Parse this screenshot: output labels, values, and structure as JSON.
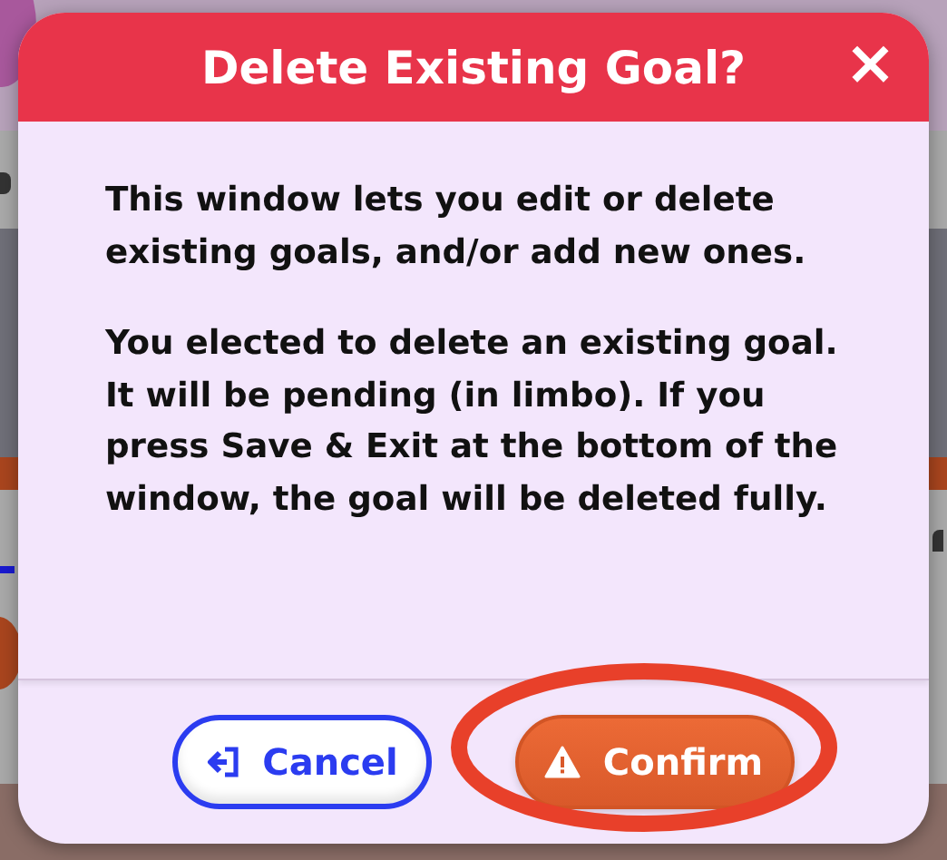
{
  "dialog": {
    "title": "Delete Existing Goal?",
    "close": "×",
    "paragraphs": [
      "This window lets you edit or delete existing goals, and/or add new ones.",
      "You elected to delete an existing goal. It will be pending (in limbo). If you press Save & Exit at the bottom of the window, the goal will be deleted fully."
    ],
    "buttons": [
      {
        "label": "Cancel",
        "kind": "cancel",
        "highlighted": false
      },
      {
        "label": "Confirm",
        "kind": "confirm",
        "highlighted": true
      }
    ]
  }
}
